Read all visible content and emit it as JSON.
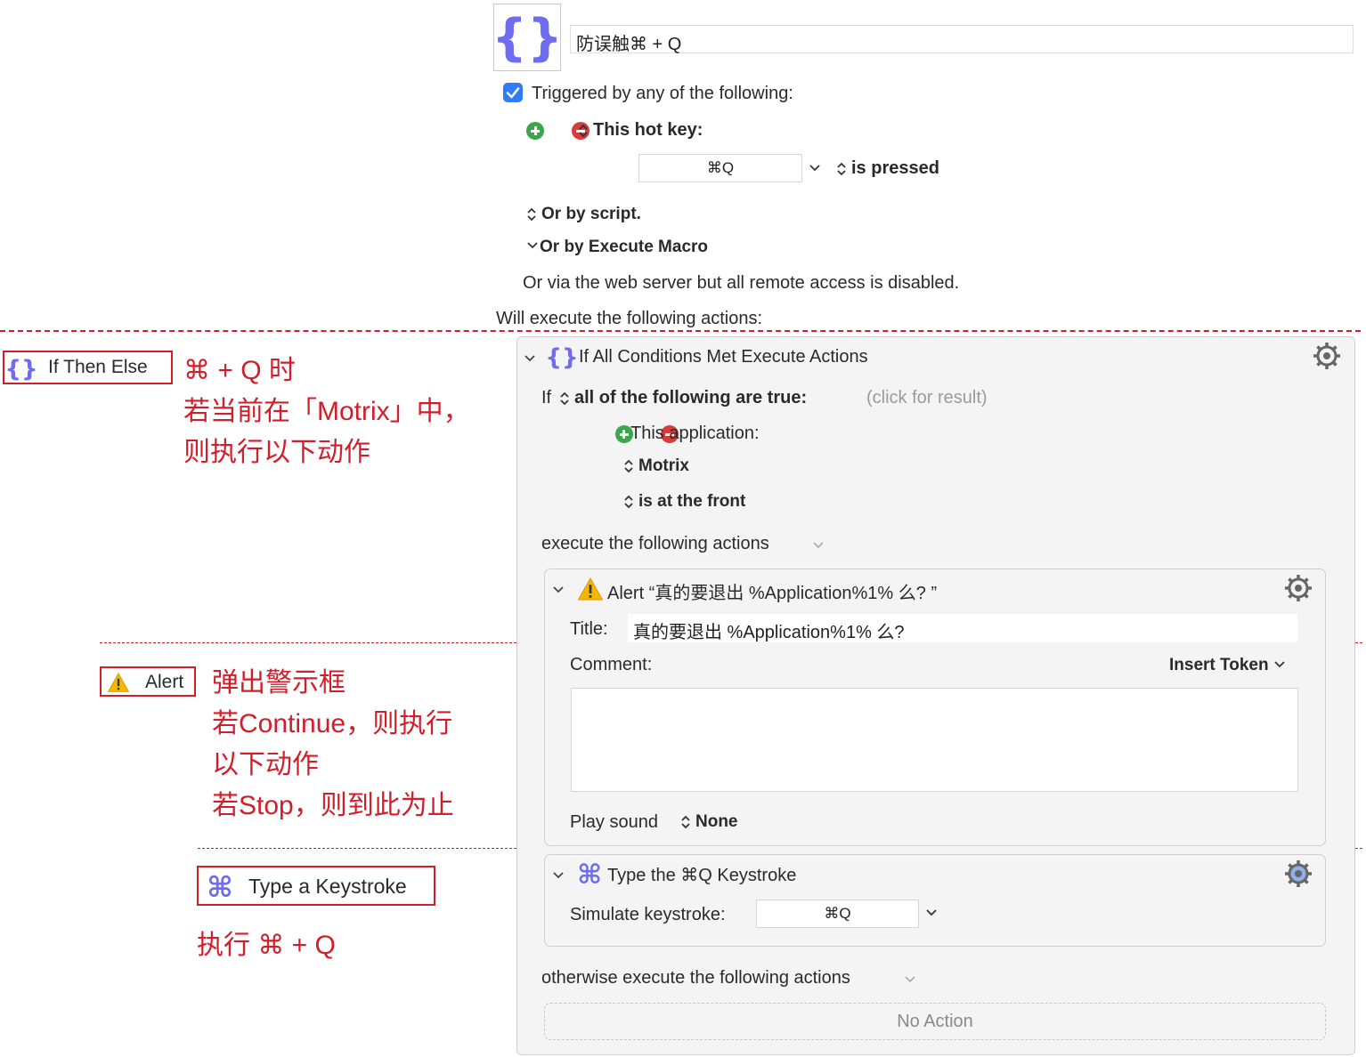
{
  "macro": {
    "name": "防误触⌘ + Q",
    "triggered_label": "Triggered by any of the following:",
    "hotkey_label": "This hot key:",
    "hotkey_value": "⌘Q",
    "hotkey_condition": "is pressed",
    "or_script": "Or by script.",
    "or_execute_macro": "Or by Execute Macro",
    "web_server": "Or via the web server but all remote access is disabled.",
    "will_execute": "Will execute the following actions:"
  },
  "if_action": {
    "title": "If All Conditions Met Execute Actions",
    "if_word": "If",
    "condition_mode": "all of the following are true:",
    "click_for_result": "(click for result)",
    "condition_type": "This application:",
    "application": "Motrix",
    "app_state": "is at the front",
    "then_label": "execute the following actions",
    "otherwise_label": "otherwise execute the following actions",
    "no_action": "No Action"
  },
  "alert_action": {
    "title": "Alert “真的要退出 %Application%1% 么? ”",
    "title_label": "Title:",
    "title_value": "真的要退出 %Application%1% 么?",
    "comment_label": "Comment:",
    "insert_token": "Insert Token",
    "play_sound_label": "Play sound",
    "play_sound_value": "None"
  },
  "type_action": {
    "title": "Type the ⌘Q Keystroke",
    "simulate_label": "Simulate keystroke:",
    "keystroke_value": "⌘Q"
  },
  "annotations": {
    "ifthen_badge": "If Then Else",
    "ifthen_lines": [
      "⌘ + Q 时",
      "若当前在「Motrix」中，",
      "则执行以下动作"
    ],
    "alert_badge": "Alert",
    "alert_lines": [
      "弹出警示框",
      "若Continue，则执行",
      "以下动作",
      "若Stop，则到此为止"
    ],
    "type_badge": "Type a Keystroke",
    "type_lines": [
      "执行 ⌘ + Q"
    ]
  },
  "colors": {
    "annotation_red": "#d21e2a",
    "checkbox_blue": "#2f7cf6",
    "icon_purple": "#6e6cf0",
    "plus_green": "#3ca64a",
    "minus_red": "#d93a3a"
  }
}
